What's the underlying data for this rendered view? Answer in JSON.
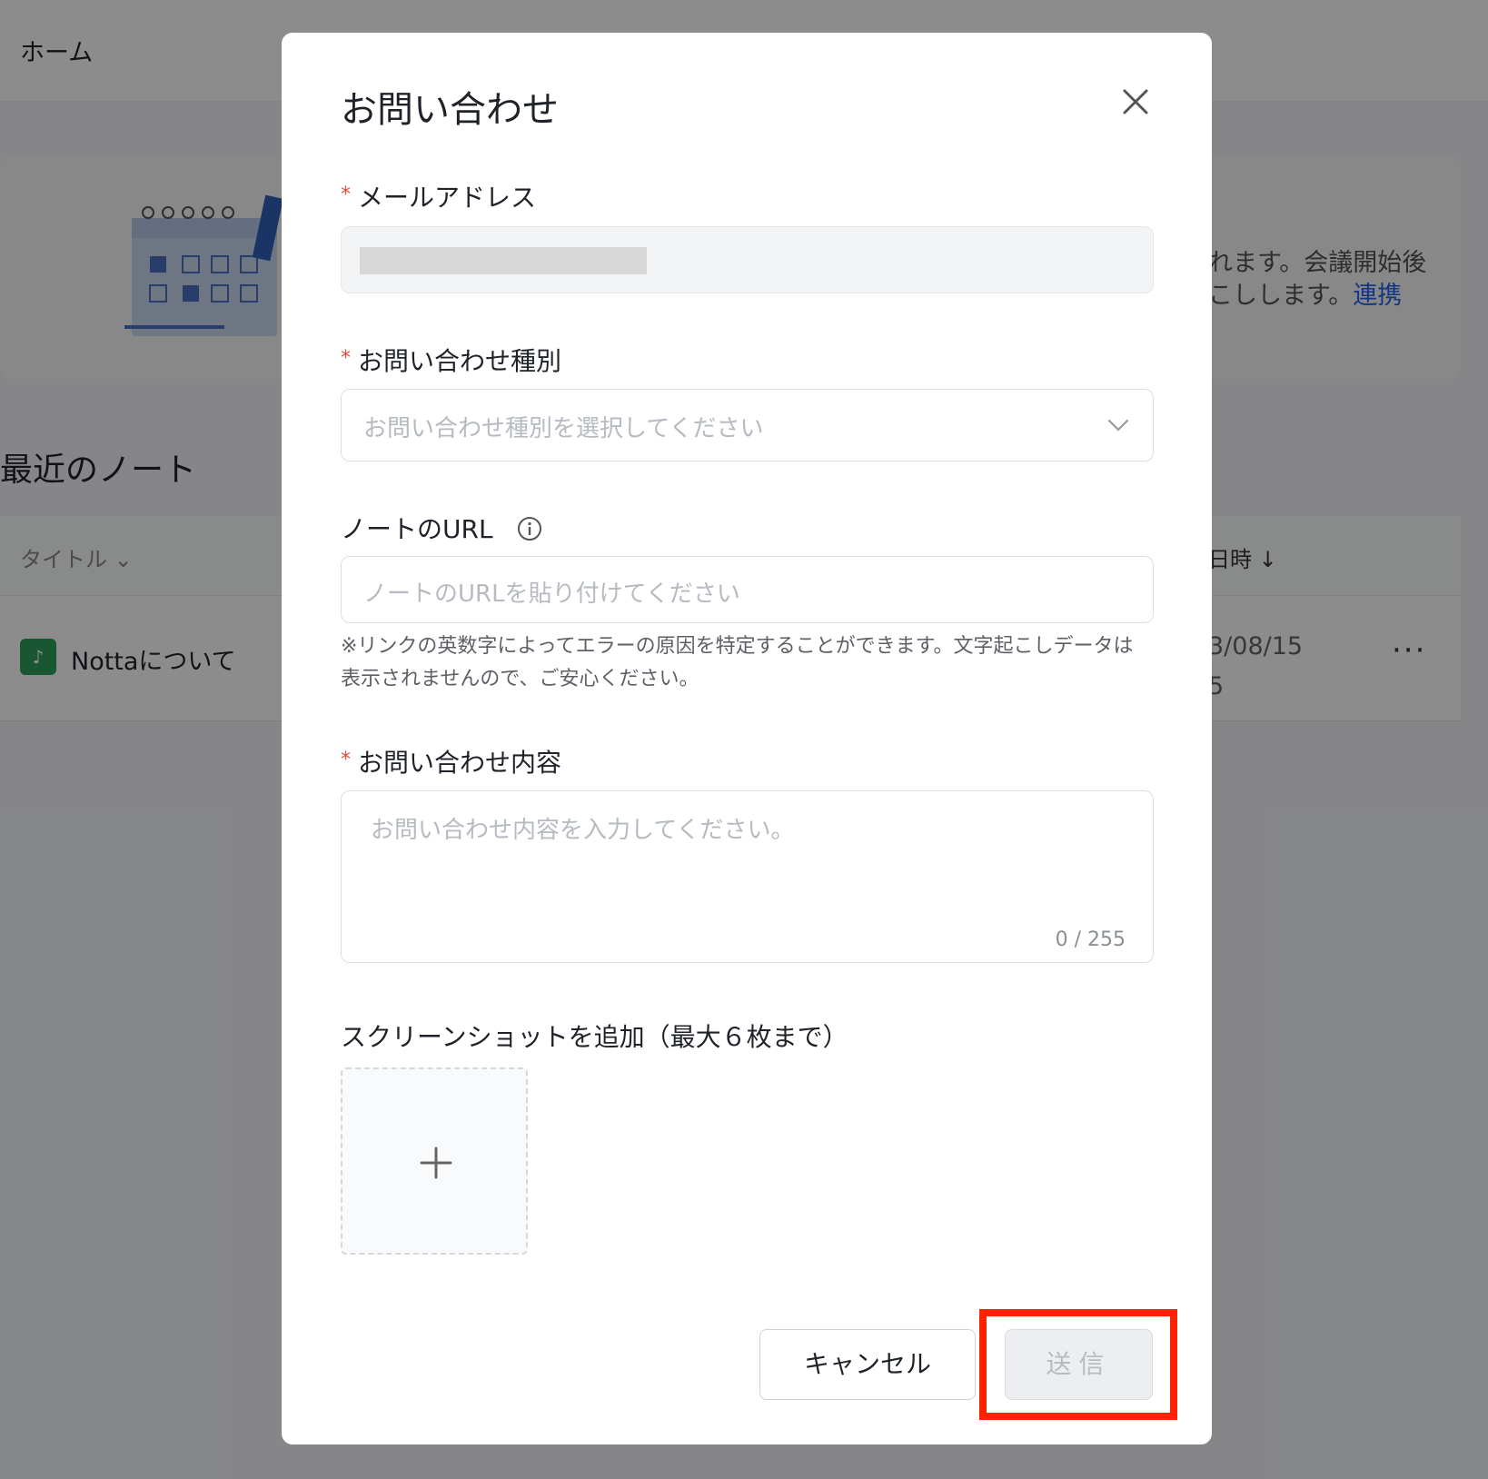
{
  "background": {
    "header_title": "ホーム",
    "banner_text_line1": "れます。会議開始後",
    "banner_text_line2": "こしします。",
    "banner_link": "連携",
    "recent_notes_title": "最近のノート",
    "table_header_title": "タイトル",
    "table_header_date": "日時 ↓",
    "rows": [
      {
        "title": "Nottaについて",
        "date_line1": "3/08/15",
        "date_line2": "5",
        "more": "···"
      }
    ]
  },
  "modal": {
    "title": "お問い合わせ",
    "close_icon": "close-icon",
    "email": {
      "label": "メールアドレス",
      "required_mark": "*"
    },
    "category": {
      "label": "お問い合わせ種別",
      "required_mark": "*",
      "placeholder": "お問い合わせ種別を選択してください"
    },
    "note_url": {
      "label": "ノートのURL",
      "placeholder": "ノートのURLを貼り付けてください",
      "hint": "※リンクの英数字によってエラーの原因を特定することができます。文字起こしデータは表示されませんので、ご安心ください。"
    },
    "content": {
      "label": "お問い合わせ内容",
      "required_mark": "*",
      "placeholder": "お問い合わせ内容を入力してください。",
      "counter": "0 / 255"
    },
    "screenshot": {
      "label": "スクリーンショットを追加（最大６枚まで）",
      "add_icon": "plus-icon"
    },
    "buttons": {
      "cancel": "キャンセル",
      "submit": "送信"
    }
  },
  "colors": {
    "required": "#e54b3c",
    "highlight": "#ff2200",
    "link": "#2563eb",
    "note_icon": "#2e9e5b"
  }
}
